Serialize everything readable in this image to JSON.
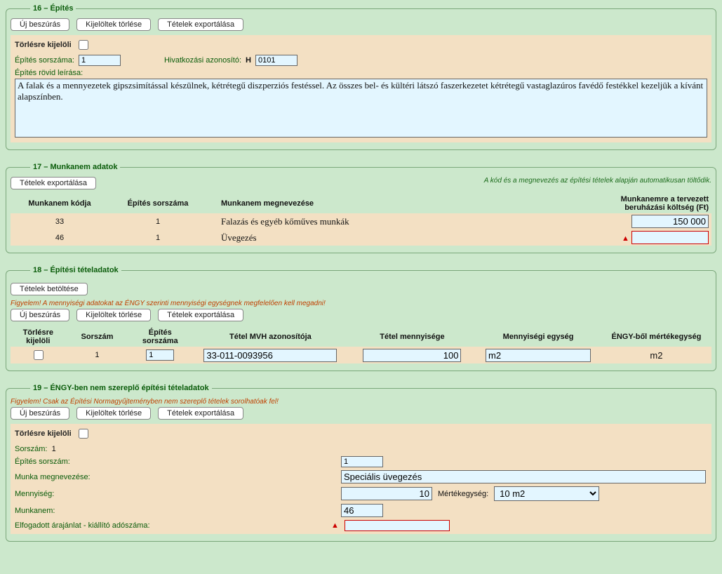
{
  "s16": {
    "legend": "16 – Építés",
    "btn_new": "Új beszúrás",
    "btn_del": "Kijelöltek törlése",
    "btn_exp": "Tételek exportálása",
    "mark_del": "Törlésre kijelöli",
    "seq_label": "Építés sorszáma:",
    "seq_val": "1",
    "ref_label": "Hivatkozási azonosító:",
    "ref_h": "H",
    "ref_val": "0101",
    "desc_label": "Építés rövid leírása:",
    "desc_val": "A falak és a mennyezetek gipszsimítással készülnek, kétrétegű diszperziós festéssel. Az összes bel- és kültéri látszó faszerkezetet kétrétegű vastaglazúros favédő festékkel kezeljük a kívánt alapszínben."
  },
  "s17": {
    "legend": "17 – Munkanem adatok",
    "btn_exp": "Tételek exportálása",
    "note": "A kód és a megnevezés az építési tételek alapján automatikusan töltődik.",
    "hdr": {
      "code": "Munkanem kódja",
      "seq": "Építés sorszáma",
      "name": "Munkanem megnevezése",
      "cost": "Munkanemre a tervezett beruházási költség (Ft)"
    },
    "rows": [
      {
        "code": "33",
        "seq": "1",
        "name": "Falazás és egyéb kőműves munkák",
        "cost": "150 000",
        "err": false
      },
      {
        "code": "46",
        "seq": "1",
        "name": "Üvegezés",
        "cost": "",
        "err": true
      }
    ]
  },
  "s18": {
    "legend": "18 – Építési tételadatok",
    "btn_load": "Tételek betöltése",
    "warn": "Figyelem! A mennyiségi adatokat az ÉNGY szerinti mennyiségi egységnek megfelelően kell megadni!",
    "btn_new": "Új beszúrás",
    "btn_del": "Kijelöltek törlése",
    "btn_exp": "Tételek exportálása",
    "hdr": {
      "mark": "Törlésre kijelöli",
      "seq": "Sorszám",
      "bseq": "Építés sorszáma",
      "mvh": "Tétel MVH azonosítója",
      "qty": "Tétel mennyisége",
      "unit": "Mennyiségi egység",
      "engy": "ÉNGY-ből mértékegység"
    },
    "row": {
      "seq": "1",
      "bseq": "1",
      "mvh": "33-011-0093956",
      "qty": "100",
      "unit": "m2",
      "engy": "m2"
    }
  },
  "s19": {
    "legend": "19 – ÉNGY-ben nem szereplő építési tételadatok",
    "warn": "Figyelem! Csak az Építési Normagyűjteményben nem szereplő tételek sorolhatóak fel!",
    "btn_new": "Új beszúrás",
    "btn_del": "Kijelöltek törlése",
    "btn_exp": "Tételek exportálása",
    "mark_del": "Törlésre kijelöli",
    "seq_label": "Sorszám:",
    "seq_val": "1",
    "bseq_label": "Építés sorszám:",
    "bseq_val": "1",
    "wname_label": "Munka megnevezése:",
    "wname_val": "Speciális üvegezés",
    "qty_label": "Mennyiség:",
    "qty_val": "10",
    "unit_label": "Mértékegység:",
    "unit_val": "10 m2",
    "mun_label": "Munkanem:",
    "mun_val": "46",
    "tax_label": "Elfogadott árajánlat - kiállító adószáma:",
    "tax_val": ""
  }
}
